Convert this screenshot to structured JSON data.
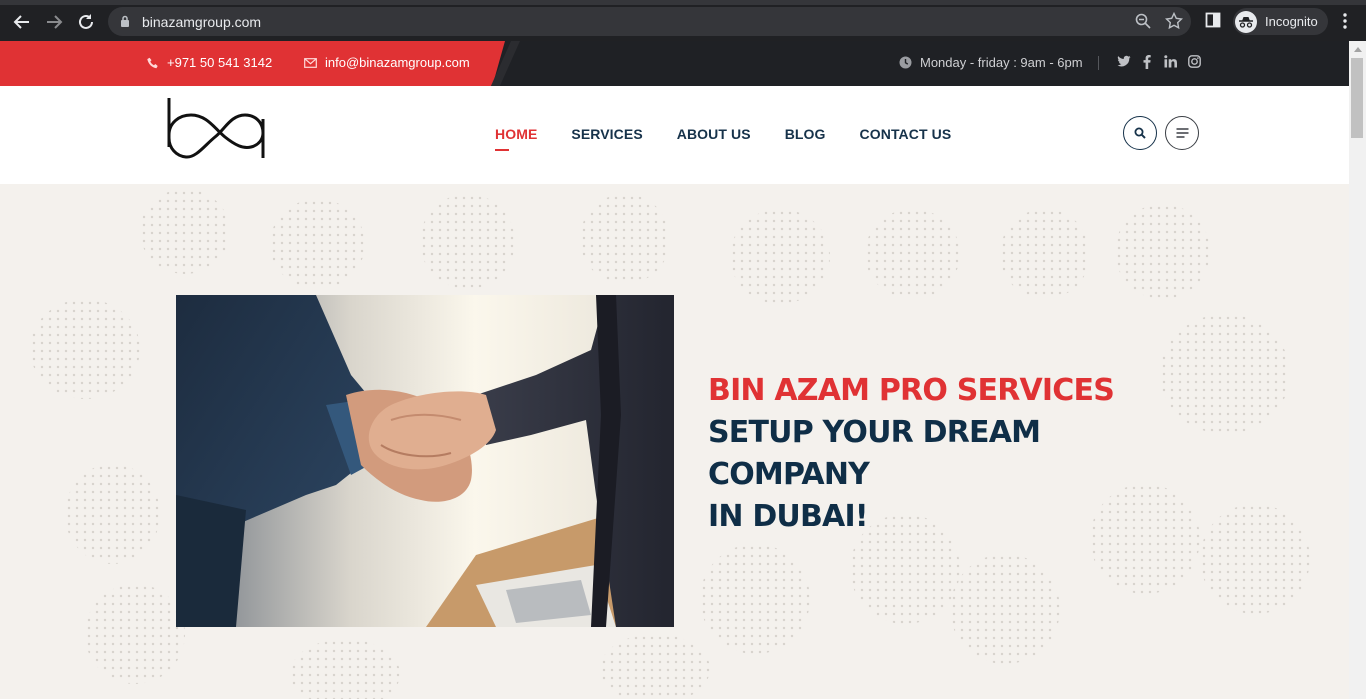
{
  "browser": {
    "url": "binazamgroup.com",
    "profile_label": "Incognito"
  },
  "topbar": {
    "phone": "+971 50 541 3142",
    "email": "info@binazamgroup.com",
    "hours": "Monday - friday : 9am - 6pm",
    "social_icons": [
      "twitter-icon",
      "facebook-icon",
      "linkedin-icon",
      "instagram-icon"
    ]
  },
  "nav": {
    "items": [
      {
        "label": "HOME",
        "active": true
      },
      {
        "label": "SERVICES",
        "active": false
      },
      {
        "label": "ABOUT US",
        "active": false
      },
      {
        "label": "BLOG",
        "active": false
      },
      {
        "label": "CONTACT US",
        "active": false
      }
    ]
  },
  "hero": {
    "line1": "BIN AZAM PRO SERVICES",
    "line2": "SETUP YOUR DREAM COMPANY",
    "line3": "IN DUBAI!"
  },
  "colors": {
    "accent_red": "#e03234",
    "navy": "#0f2e47",
    "topbar_dark": "#1f2125",
    "hero_bg": "#f4f1ed"
  }
}
